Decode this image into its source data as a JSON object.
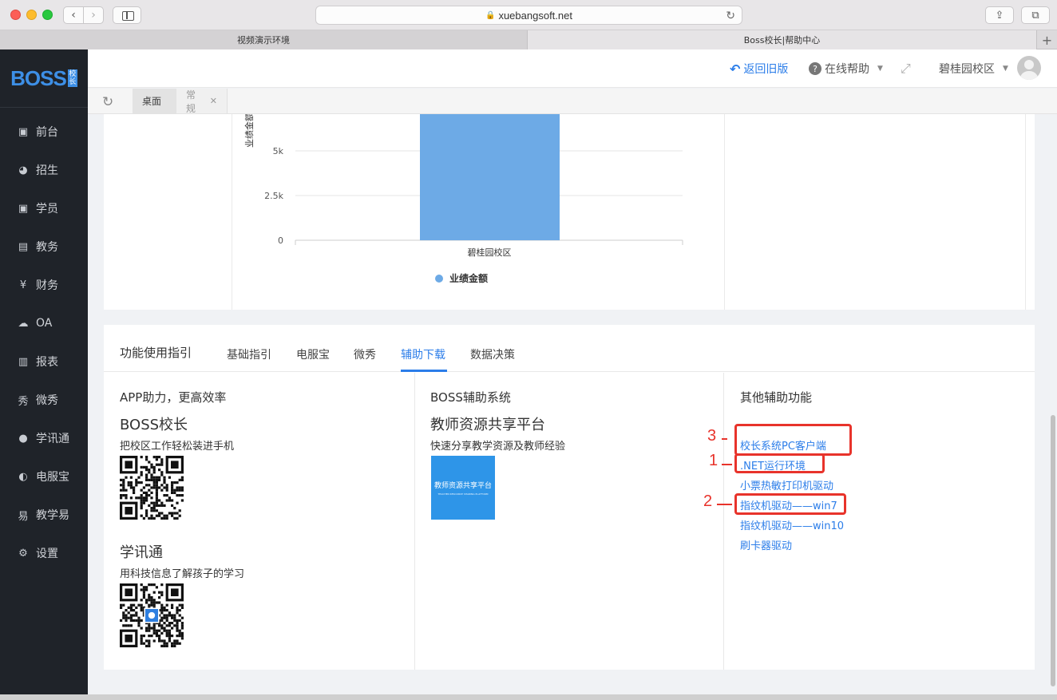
{
  "browser": {
    "url": "xuebangsoft.net",
    "tabs": [
      "视频演示环境",
      "Boss校长|帮助中心"
    ]
  },
  "app": {
    "logo_text": "BOSS",
    "logo_badge": "校长",
    "menu": [
      {
        "label": "前台",
        "icon": "calendar-icon"
      },
      {
        "label": "招生",
        "icon": "user-add-icon"
      },
      {
        "label": "学员",
        "icon": "student-card-icon"
      },
      {
        "label": "教务",
        "icon": "book-icon"
      },
      {
        "label": "财务",
        "icon": "yen-icon"
      },
      {
        "label": "OA",
        "icon": "cloud-icon"
      },
      {
        "label": "报表",
        "icon": "bar-chart-icon"
      },
      {
        "label": "微秀",
        "icon": "show-icon"
      },
      {
        "label": "学讯通",
        "icon": "location-icon"
      },
      {
        "label": "电服宝",
        "icon": "phone-icon"
      },
      {
        "label": "教学易",
        "icon": "teach-icon"
      },
      {
        "label": "设置",
        "icon": "gear-icon"
      }
    ]
  },
  "header": {
    "back_label": "返回旧版",
    "help_label": "在线帮助",
    "campus_label": "碧桂园校区"
  },
  "page_tabs": [
    "桌面",
    "常规"
  ],
  "chart_data": {
    "type": "bar",
    "ylabel": "业绩金额",
    "categories": [
      "碧桂园校区"
    ],
    "series": [
      {
        "name": "业绩金额",
        "values": [
          7800
        ]
      }
    ],
    "yticks": [
      "0",
      "2.5k",
      "5k"
    ],
    "ylim": [
      0,
      7000
    ],
    "color": "#6daae6"
  },
  "guide": {
    "title": "功能使用指引",
    "tabs": [
      "基础指引",
      "电服宝",
      "微秀",
      "辅助下载",
      "数据决策"
    ],
    "active_tab": "辅助下载",
    "col1": {
      "heading": "APP助力，更高效率",
      "app1_title": "BOSS校长",
      "app1_desc": "把校区工作轻松装进手机",
      "app2_title": "学讯通",
      "app2_desc": "用科技信息了解孩子的学习"
    },
    "col2": {
      "heading": "BOSS辅助系统",
      "title": "教师资源共享平台",
      "desc": "快速分享教学资源及教师经验",
      "img_text": "教师资源共享平台",
      "img_subtext": "TEACHER RESOURCE SHARING PLATFORM"
    },
    "col3": {
      "heading": "其他辅助功能",
      "links": [
        "校长系统PC客户端",
        ".NET运行环境",
        "小票热敏打印机驱动",
        "指纹机驱动——win7",
        "指纹机驱动——win10",
        "刷卡器驱动"
      ]
    }
  },
  "annotations": [
    "3",
    "1",
    "2"
  ]
}
